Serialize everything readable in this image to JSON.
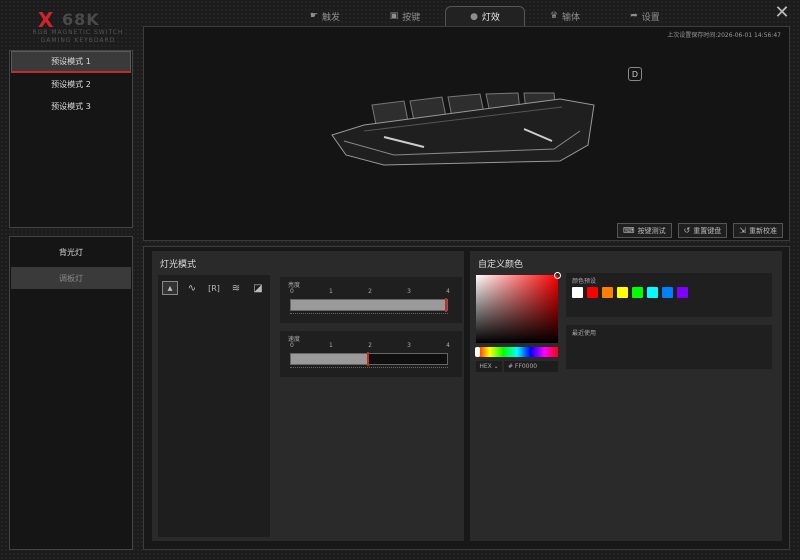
{
  "logo": {
    "mark": "X",
    "model": "68K",
    "line1": "RGB MAGNETIC SWITCH",
    "line2": "GAMING KEYBOARD"
  },
  "nav": [
    {
      "label": "触发",
      "icon": "hand-icon"
    },
    {
      "label": "按键",
      "icon": "key-icon"
    },
    {
      "label": "灯效",
      "icon": "bulb-icon",
      "active": true
    },
    {
      "label": "输体",
      "icon": "crown-icon"
    },
    {
      "label": "设置",
      "icon": "share-icon"
    }
  ],
  "presets": [
    "预设模式 1",
    "预设模式 2",
    "预设模式 3"
  ],
  "light_tabs": [
    "背光灯",
    "调板灯"
  ],
  "preview": {
    "saved_time": "上次设置保存时间:2026-06-01 14:56:47",
    "badge": "D"
  },
  "toolbar": {
    "key_test": "按键测试",
    "reset_keyboard": "重置键盘",
    "recalibrate": "重新校准"
  },
  "light_mode": {
    "title": "灯光模式",
    "brightness": {
      "label": "亮度",
      "value": 4,
      "max": 4
    },
    "speed": {
      "label": "速度",
      "value": 2,
      "max": 4
    },
    "ticks": [
      "0",
      "1",
      "2",
      "3",
      "4"
    ]
  },
  "custom_color": {
    "title": "自定义颜色",
    "format": "HEX",
    "hex_value": "# FF0000",
    "preset_label": "颜色预设",
    "recent_label": "最近使用",
    "swatches": [
      "#ffffff",
      "#ff0000",
      "#ff7f00",
      "#ffff00",
      "#00ff00",
      "#00ffff",
      "#0080ff",
      "#8000ff"
    ]
  }
}
